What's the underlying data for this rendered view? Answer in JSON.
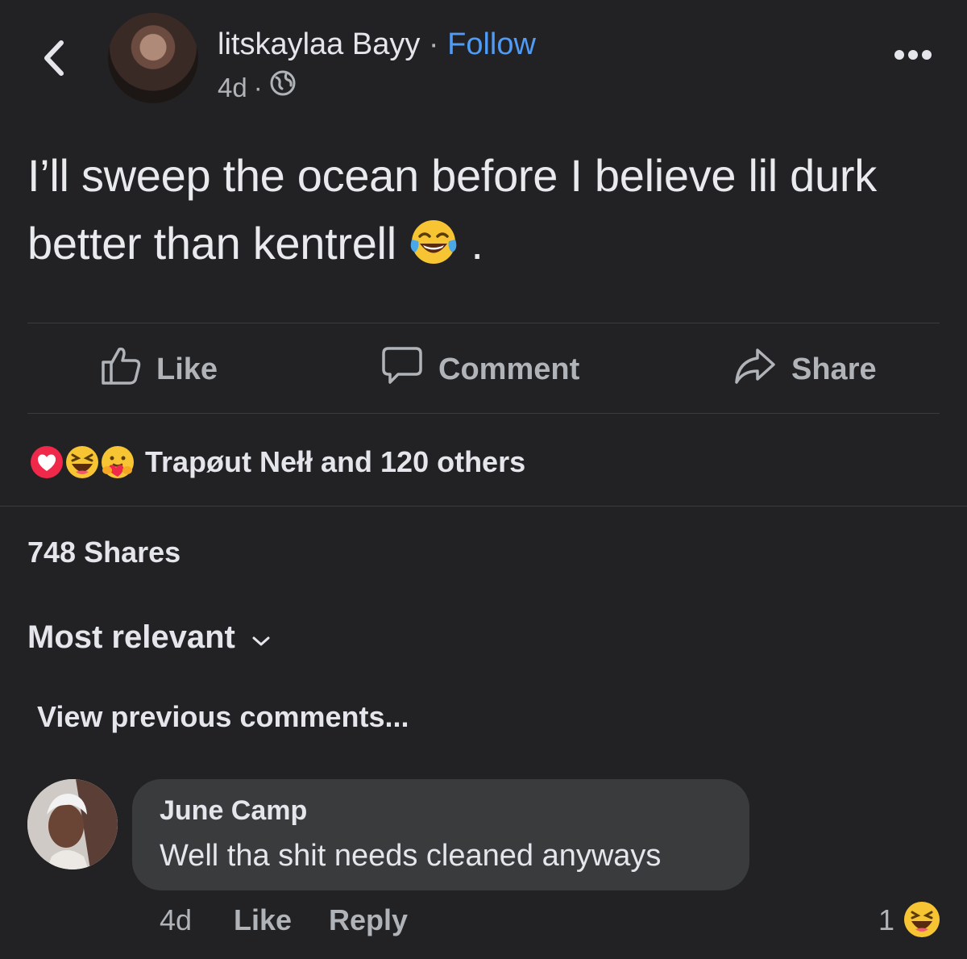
{
  "header": {
    "author_name": "litskaylaa Bayy",
    "separator": "·",
    "follow_label": "Follow",
    "time": "4d",
    "time_separator": "·",
    "privacy_icon": "globe-icon",
    "back_icon": "chevron-left-icon",
    "more_icon": "more-horizontal-icon"
  },
  "post": {
    "text": "I’ll sweep the ocean before I believe lil durk better than kentrell",
    "emoji": "tears-of-joy-emoji",
    "text_end": "."
  },
  "actions": {
    "like_label": "Like",
    "comment_label": "Comment",
    "share_label": "Share"
  },
  "reactions": {
    "icons": [
      "love-reaction-icon",
      "haha-reaction-icon",
      "care-reaction-icon"
    ],
    "summary": "Trapøut Nełł and 120 others"
  },
  "shares": {
    "label": "748 Shares"
  },
  "comments_section": {
    "sort_label": "Most relevant",
    "view_previous_label": "View previous comments..."
  },
  "comment": {
    "author": "June Camp",
    "text": "Well tha shit needs cleaned anyways",
    "time": "4d",
    "like_label": "Like",
    "reply_label": "Reply",
    "reaction_count": "1",
    "reaction_icon": "haha-reaction-icon"
  },
  "colors": {
    "background": "#222224",
    "accent": "#4f9bf5",
    "text_primary": "#e4e6eb",
    "text_secondary": "#b0b3b8",
    "bubble": "#3a3b3d"
  }
}
